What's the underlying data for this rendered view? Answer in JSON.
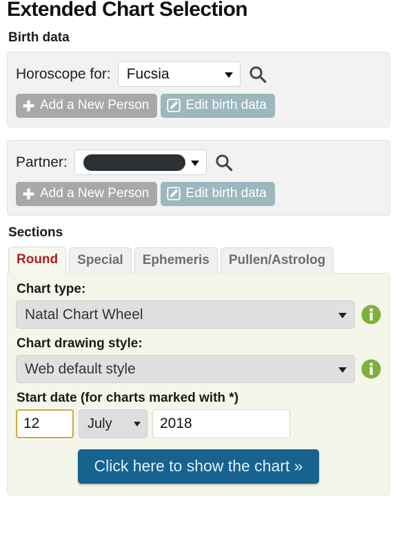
{
  "header": {
    "title": "Extended Chart Selection"
  },
  "birth_data": {
    "heading": "Birth data",
    "person": {
      "label": "Horoscope for:",
      "selected": "Fucsia",
      "search_icon": "search-icon",
      "add_button": "Add a New Person",
      "add_icon": "plus-icon",
      "edit_button": "Edit birth data",
      "edit_icon": "pencil-square-icon"
    },
    "partner": {
      "label": "Partner:",
      "selected": "",
      "redacted": true,
      "search_icon": "search-icon",
      "add_button": "Add a New Person",
      "add_icon": "plus-icon",
      "edit_button": "Edit birth data",
      "edit_icon": "pencil-square-icon"
    }
  },
  "sections": {
    "heading": "Sections",
    "tabs": [
      {
        "label": "Round",
        "active": true
      },
      {
        "label": "Special",
        "active": false
      },
      {
        "label": "Ephemeris",
        "active": false
      },
      {
        "label": "Pullen/Astrolog",
        "active": false
      }
    ]
  },
  "form": {
    "chart_type": {
      "label": "Chart type:",
      "selected": "Natal Chart Wheel",
      "info_icon": "info-icon"
    },
    "chart_style": {
      "label": "Chart drawing style:",
      "selected": "Web default style",
      "info_icon": "info-icon"
    },
    "start_date": {
      "label": "Start date (for charts marked with *)",
      "day": "12",
      "month": "July",
      "year": "2018"
    },
    "submit_label": "Click here to show the chart »"
  },
  "colors": {
    "accent_blue": "#17628f",
    "active_tab_red": "#b01c1c",
    "info_green": "#7fb03c",
    "focus_gold": "#cda63f",
    "panel_grey": "#f2f2f2",
    "panel_green": "#f4f6ea",
    "button_grey": "#a8a8a8",
    "button_teal": "#9cb7bd",
    "redaction_black": "#2b3035"
  }
}
